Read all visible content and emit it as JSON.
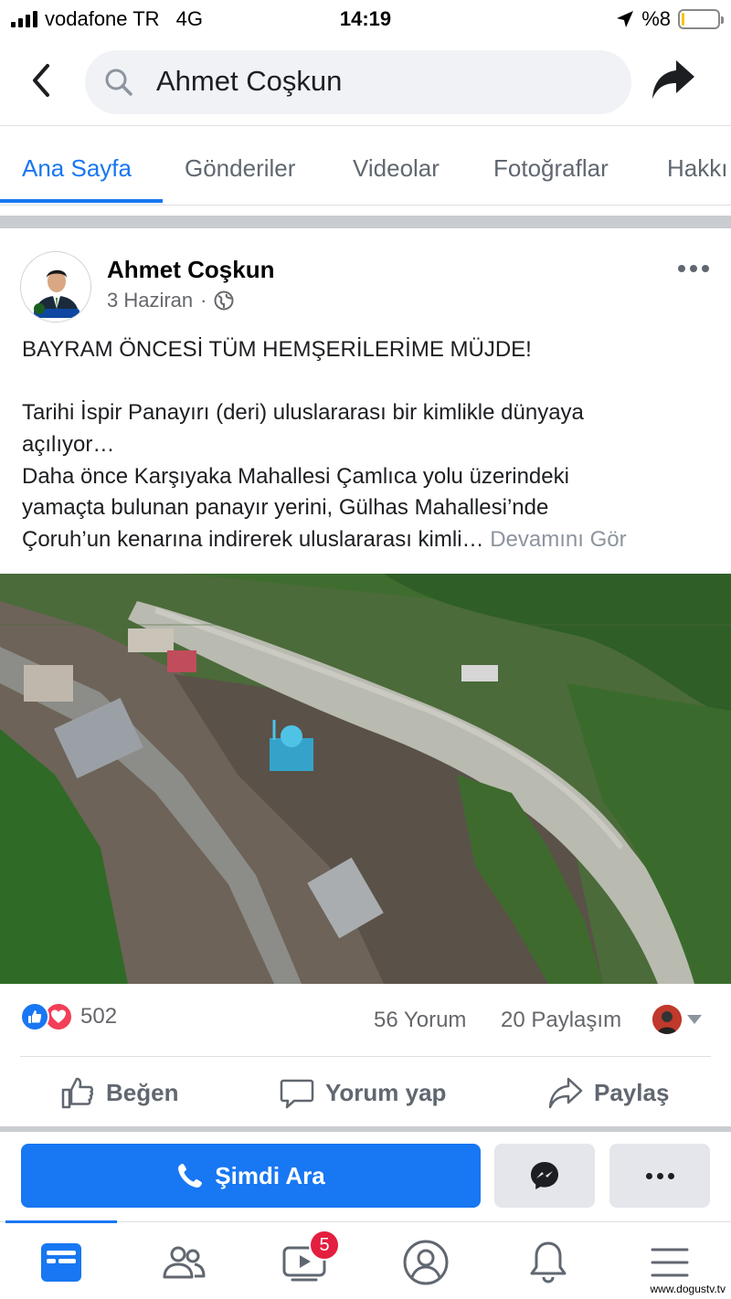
{
  "status_bar": {
    "carrier": "vodafone TR",
    "network": "4G",
    "time": "14:19",
    "battery": "%8",
    "battery_level": 0.08
  },
  "header": {
    "search_text": "Ahmet Coşkun"
  },
  "tabs": [
    {
      "label": "Ana Sayfa",
      "active": true
    },
    {
      "label": "Gönderiler"
    },
    {
      "label": "Videolar"
    },
    {
      "label": "Fotoğraflar"
    },
    {
      "label": "Hakkı"
    }
  ],
  "post": {
    "author": "Ahmet Coşkun",
    "date": "3 Haziran",
    "separator": "·",
    "headline": "BAYRAM ÖNCESİ TÜM HEMŞERİLERİME MÜJDE!",
    "body_line_1": "Tarihi İspir Panayırı (deri) uluslararası bir kimlikle dünyaya",
    "body_line_2": "açılıyor…",
    "body_line_3": "Daha önce Karşıyaka Mahallesi Çamlıca yolu üzerindeki",
    "body_line_4": "yamaçta bulunan panayır yerini, Gülhas Mahallesi’nde",
    "body_line_5": "Çoruh’un kenarına indirerek uluslararası kimli…",
    "see_more": "Devamını Gör",
    "reactions_count": "502",
    "comments": "56 Yorum",
    "shares": "20 Paylaşım"
  },
  "actions": {
    "like": "Beğen",
    "comment": "Yorum yap",
    "share": "Paylaş"
  },
  "cta": {
    "call": "Şimdi Ara"
  },
  "bottom_nav": {
    "video_badge": "5"
  },
  "watermark": "www.dogustv.tv",
  "colors": {
    "accent": "#1877f2",
    "badge": "#e41e3f",
    "love": "#f33e58"
  }
}
